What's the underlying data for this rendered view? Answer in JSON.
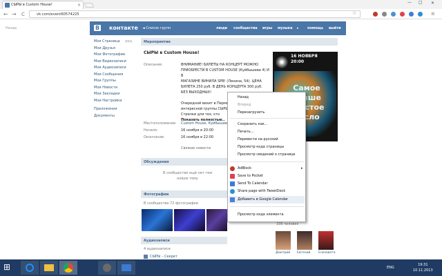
{
  "browser": {
    "tab_title": "СЫРЫ в Custom House!",
    "url": "vk.com/event60574225",
    "close_tab": "×",
    "win_minimize": "—",
    "win_maximize": "□",
    "win_close": "✕",
    "back_glyph": "←",
    "forward_glyph": "→",
    "reload_glyph": "C",
    "star_glyph": "☆",
    "menu_glyph": "≡"
  },
  "leftlink": "Назад",
  "vk": {
    "logo_b": "В",
    "logo_text": "контакте",
    "groups_link": "◄ Список групп",
    "nav": [
      "люди",
      "сообщества",
      "игры",
      "музыка",
      "помощь",
      "выйти"
    ],
    "nav_arrow": "▸",
    "menu": [
      "Моя Страница",
      "Мои Друзья",
      "Мои Фотографии",
      "Мои Видеозаписи",
      "Мои Аудиозаписи",
      "Мои Сообщения",
      "Мои Группы",
      "Мои Новости",
      "Мои Закладки",
      "Мои Настройки",
      "Приложения",
      "Документы"
    ],
    "menu_edit": "ред."
  },
  "event": {
    "section_title": "Мероприятие",
    "title": "СЫРЫ в Custom House!",
    "description_label": "Описание:",
    "description": [
      "ВНИМАНИЕ! БИЛЕТЫ НА КОНЦЕРТ МОЖНО",
      "ПРИОБРЕСТИ В CUSTOM HOUSE (Куйбышева 4) И В",
      "МАГАЗИНЕ ВИНИЛА SPB! (Ленина, 54). ЦЕНА",
      "БИЛЕТА 250 руб. В ДЕНЬ КОНЦЕРТА 300 руб.",
      "БЕЗ ВЫХОДНЫХ!",
      "",
      "Очередной визит в Пермь",
      "интересной группы СЫРЫ. В",
      "Стрелки для тех, кто"
    ],
    "show_full": "Показать полностью..",
    "location_label": "Местоположение:",
    "location": "Custom House, Куйбышева",
    "start_label": "Начало:",
    "start": "16 ноября в 20:00",
    "end_label": "Окончание:",
    "end": "16 ноября в 22:00",
    "latest_news": "Свежие новости",
    "discussions_header": "Обсуждения",
    "discussions_empty": [
      "В сообществе ещё нет тем",
      "новую тему"
    ],
    "photos_header": "Фотографии",
    "photos_sub": "В сообществе 72 фотографии",
    "audio_header": "Аудиозаписи",
    "audio_sub": "4 аудиозаписи",
    "audio_item": "СЫРЫ – Секрет",
    "members_count": "336 человек",
    "members": [
      "Дмитрий",
      "Евгений",
      "Елизавета"
    ]
  },
  "poster": {
    "date": "16 НОЯБРЯ",
    "time": "20:00",
    "art_text": [
      "Самое",
      "лучше",
      "простое",
      "число"
    ]
  },
  "context_menu": {
    "items": [
      {
        "label": "Назад",
        "disabled": false
      },
      {
        "label": "Вперед",
        "disabled": true
      },
      {
        "label": "Перезагрузить",
        "disabled": false
      },
      {
        "label": "Сохранить как...",
        "disabled": false
      },
      {
        "label": "Печать...",
        "disabled": false
      },
      {
        "label": "Перевести на русский",
        "disabled": false
      },
      {
        "label": "Просмотр кода страницы",
        "disabled": false
      },
      {
        "label": "Просмотр сведений о странице",
        "disabled": false
      },
      {
        "label": "AdBlock",
        "disabled": false
      },
      {
        "label": "Save to Pocket",
        "disabled": false
      },
      {
        "label": "Send To Calendar",
        "disabled": false
      },
      {
        "label": "Share page with TweetDeck",
        "disabled": false
      },
      {
        "label": "Добавить в Google Calendar",
        "disabled": false
      },
      {
        "label": "Просмотр кода элемента",
        "disabled": false
      }
    ],
    "submenu_arrow": "▸"
  },
  "taskbar": {
    "start_glyph": "⊞",
    "lang": "ENG",
    "time": "19:31",
    "date": "10.11.2013",
    "colors": {
      "start": "#0078d7",
      "ie": "#1e90ff",
      "explorer": "#f0c040",
      "chrome": "#dd4b39",
      "app4": "#6a6a6a",
      "app5": "#3a7bd5"
    }
  }
}
